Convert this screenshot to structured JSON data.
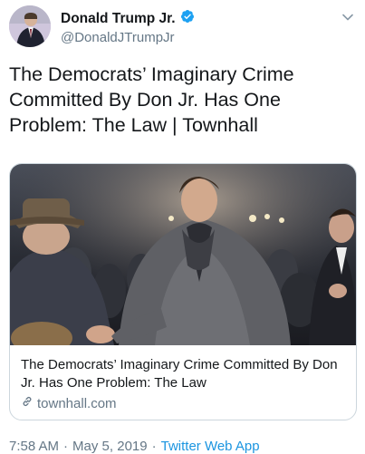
{
  "author": {
    "display_name": "Donald Trump Jr.",
    "handle": "@DonaldJTrumpJr",
    "verified": true
  },
  "tweet": {
    "text": "The Democrats’ Imaginary Crime Committed By Don Jr. Has One Problem: The Law | Townhall"
  },
  "card": {
    "title": "The Democrats’ Imaginary Crime Committed By Don Jr. Has One Problem: The Law",
    "domain": "townhall.com"
  },
  "meta": {
    "time": "7:58 AM",
    "date": "May 5, 2019",
    "source": "Twitter Web App"
  },
  "colors": {
    "link_blue": "#1b95e0",
    "verified_blue": "#1da1f2",
    "secondary_text": "#657786",
    "border": "#ccd6dd"
  },
  "icons": {
    "verified": "verified-badge-icon",
    "more": "chevron-down-icon",
    "link": "link-icon"
  }
}
